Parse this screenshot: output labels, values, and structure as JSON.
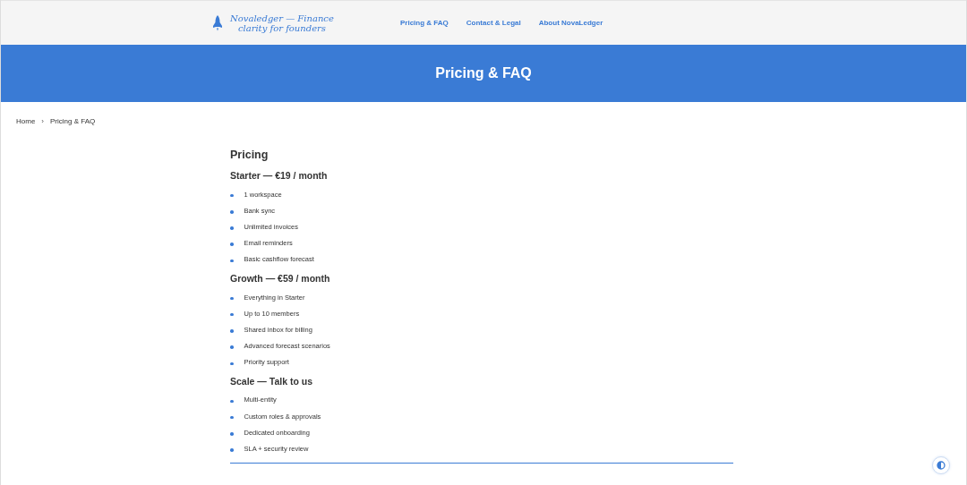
{
  "header": {
    "logo_lines": [
      "Novaledger — Finance",
      "clarity for founders"
    ],
    "nav": [
      "Pricing & FAQ",
      "Contact & Legal",
      "About NovaLedger"
    ]
  },
  "banner": {
    "title": "Pricing & FAQ"
  },
  "breadcrumb": {
    "items": [
      "Home",
      "Pricing & FAQ"
    ],
    "separator": "›"
  },
  "content": {
    "heading": "Pricing",
    "plans": [
      {
        "title": "Starter — €19 / month",
        "features": [
          "1 workspace",
          "Bank sync",
          "Unlimited invoices",
          "Email reminders",
          "Basic cashflow forecast"
        ]
      },
      {
        "title": "Growth — €59 / month",
        "features": [
          "Everything in Starter",
          "Up to 10 members",
          "Shared inbox for billing",
          "Advanced forecast scenarios",
          "Priority support"
        ]
      },
      {
        "title": "Scale — Talk to us",
        "features": [
          "Multi-entity",
          "Custom roles & approvals",
          "Dedicated onboarding",
          "SLA + security review"
        ]
      }
    ]
  }
}
